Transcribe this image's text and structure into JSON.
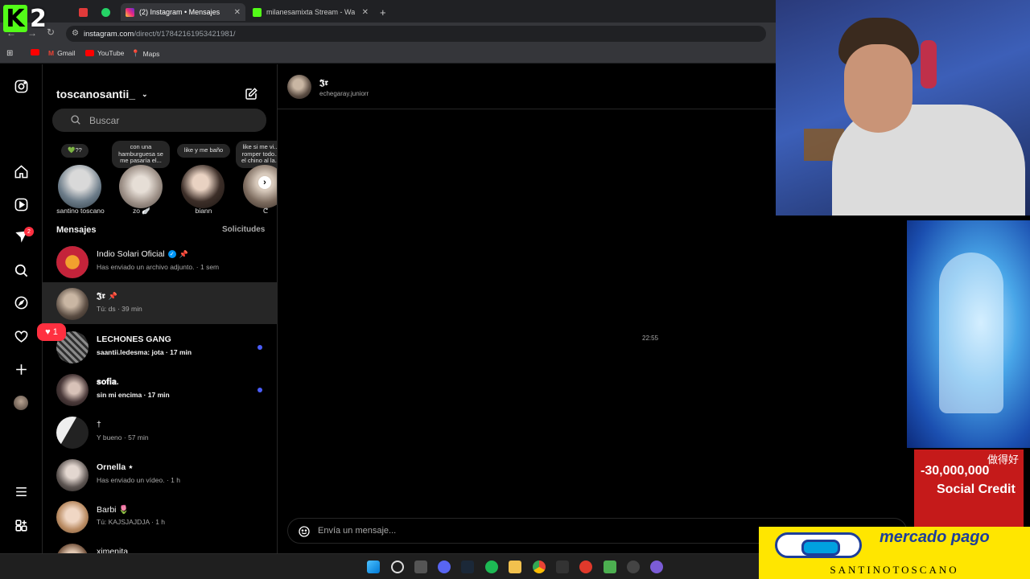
{
  "browser": {
    "tabs": [
      {
        "label": "(2) Instagram • Mensajes",
        "active": true
      },
      {
        "label": "milanesamixta Stream - Watch",
        "active": false
      }
    ],
    "url_host": "instagram.com",
    "url_path": "/direct/t/17842161953421981/",
    "bookmarks": [
      "Gmail",
      "YouTube",
      "Maps"
    ],
    "new_tab": "+"
  },
  "overlay": {
    "logo_letter": "K",
    "logo_number": "2",
    "credit_cn": "做得好",
    "credit_amount": "-30,000,000",
    "credit_text": "Social Credit",
    "mp_title": "mercado pago",
    "mp_name": "SANTINOTOSCANO"
  },
  "sidebar": {
    "notifications_badge": "2",
    "likes_count": "1"
  },
  "inbox": {
    "username": "toscanosantii_",
    "search_placeholder": "Buscar",
    "messages_heading": "Mensajes",
    "requests_label": "Solicitudes",
    "notes": [
      {
        "note": "💚??",
        "name": "santino toscano"
      },
      {
        "note": "con una hamburguesa se me pasaría el...",
        "name": "zo 🪽"
      },
      {
        "note": "like y me baño",
        "name": "biann"
      },
      {
        "note": "like si me vi... romper todo... el chino al la...",
        "name": "ᕦ"
      }
    ],
    "conversations": [
      {
        "name": "Indio Solari Oficial",
        "preview": "Has enviado un archivo adjunto. · 1 sem",
        "verified": true,
        "pinned": true,
        "unread": false
      },
      {
        "name": "𝕵𝖗",
        "preview": "Tú: ds · 39 min",
        "verified": false,
        "pinned": true,
        "unread": false
      },
      {
        "name": "LECHONES GANG",
        "preview": "saantii.ledesma: jota · 17 min",
        "verified": false,
        "pinned": false,
        "unread": true
      },
      {
        "name": "𝐬𝐨𝐟𝐢𝐚.",
        "preview": "sin mi encima · 17 min",
        "verified": false,
        "pinned": false,
        "unread": true
      },
      {
        "name": "†",
        "preview": "Y bueno · 57 min",
        "verified": false,
        "pinned": false,
        "unread": false
      },
      {
        "name": "Ornella ⋆",
        "preview": "Has enviado un vídeo. · 1 h",
        "verified": false,
        "pinned": false,
        "unread": false
      },
      {
        "name": "Barbi 🌷",
        "preview": "Tú: KAJSJAJDJA · 1 h",
        "verified": false,
        "pinned": false,
        "unread": false
      },
      {
        "name": "ximenita",
        "preview": "",
        "verified": false,
        "pinned": false,
        "unread": false
      }
    ]
  },
  "chat": {
    "name": "𝕵𝖗",
    "handle": "echegaray.juniorr",
    "timestamp": "22:55",
    "composer_placeholder": "Envía un mensaje..."
  }
}
